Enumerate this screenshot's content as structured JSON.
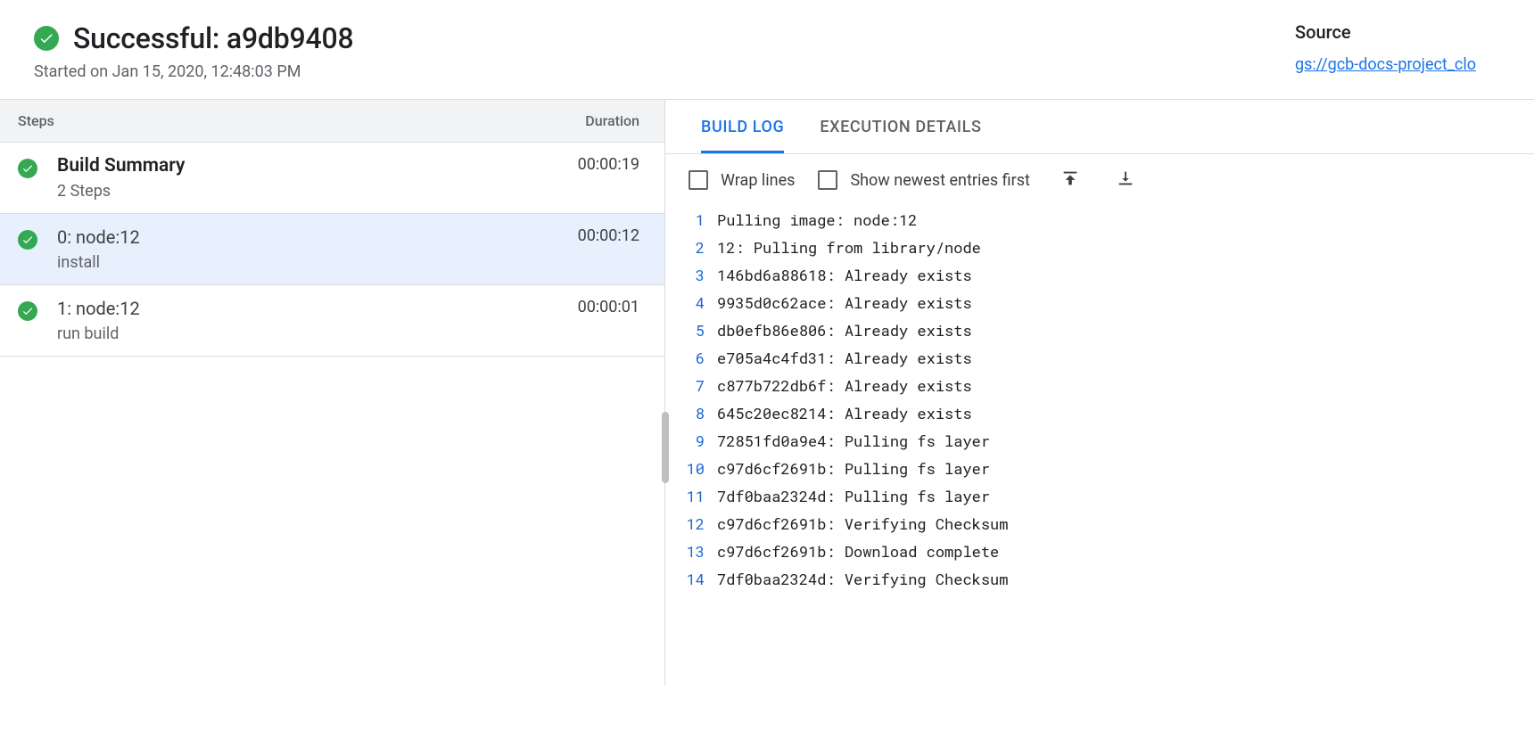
{
  "header": {
    "status": "Successful",
    "build_id": "a9db9408",
    "title": "Successful: a9db9408",
    "started_on": "Started on Jan 15, 2020, 12:48:03 PM",
    "source_label": "Source",
    "source_link": "gs://gcb-docs-project_clo"
  },
  "steps_panel": {
    "col_steps": "Steps",
    "col_duration": "Duration",
    "summary": {
      "name": "Build Summary",
      "desc": "2 Steps",
      "duration": "00:00:19"
    },
    "steps": [
      {
        "name": "0: node:12",
        "desc": "install",
        "duration": "00:00:12",
        "selected": true
      },
      {
        "name": "1: node:12",
        "desc": "run build",
        "duration": "00:00:01",
        "selected": false
      }
    ]
  },
  "tabs": {
    "build_log": "BUILD LOG",
    "execution_details": "EXECUTION DETAILS",
    "active": "build_log"
  },
  "toolbar": {
    "wrap_lines": "Wrap lines",
    "newest_first": "Show newest entries first"
  },
  "log": [
    "Pulling image: node:12",
    "12: Pulling from library/node",
    "146bd6a88618: Already exists",
    "9935d0c62ace: Already exists",
    "db0efb86e806: Already exists",
    "e705a4c4fd31: Already exists",
    "c877b722db6f: Already exists",
    "645c20ec8214: Already exists",
    "72851fd0a9e4: Pulling fs layer",
    "c97d6cf2691b: Pulling fs layer",
    "7df0baa2324d: Pulling fs layer",
    "c97d6cf2691b: Verifying Checksum",
    "c97d6cf2691b: Download complete",
    "7df0baa2324d: Verifying Checksum"
  ]
}
